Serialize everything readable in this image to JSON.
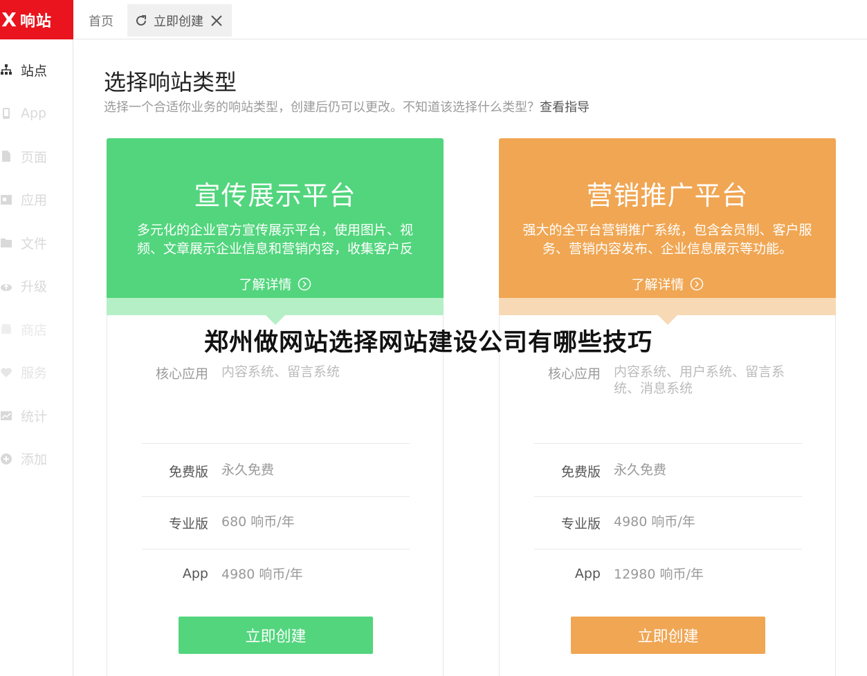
{
  "app": {
    "logo_mark": "X",
    "logo_text": "响站",
    "brand_color": "#e9141d"
  },
  "tabs": {
    "home": "首页",
    "current": "立即创建"
  },
  "sidebar": {
    "items": [
      {
        "label": "站点",
        "icon": "sitemap-icon"
      },
      {
        "label": "App",
        "icon": "mobile-icon"
      },
      {
        "label": "页面",
        "icon": "page-icon"
      },
      {
        "label": "应用",
        "icon": "app-icon"
      },
      {
        "label": "文件",
        "icon": "folder-icon"
      },
      {
        "label": "升级",
        "icon": "cloud-upload-icon"
      },
      {
        "label": "商店",
        "icon": "store-icon"
      },
      {
        "label": "服务",
        "icon": "heart-icon"
      },
      {
        "label": "统计",
        "icon": "chart-icon"
      },
      {
        "label": "添加",
        "icon": "plus-circle-icon"
      }
    ]
  },
  "main": {
    "title": "选择响站类型",
    "subtitle": "选择一个合适你业务的响站类型，创建后仍可以更改。不知道该选择什么类型？",
    "guide_link": "查看指导"
  },
  "cards": [
    {
      "title": "宣传展示平台",
      "desc": "多元化的企业官方宣传展示平台，使用图片、视频、文章展示企业信息和营销内容，收集客户反",
      "more": "了解详情",
      "core_label": "核心应用",
      "core_value": "内容系统、留言系统",
      "rows": [
        {
          "k": "免费版",
          "v": "永久免费"
        },
        {
          "k": "专业版",
          "v": "680 响币/年"
        },
        {
          "k": "App",
          "v": "4980 响币/年"
        }
      ],
      "cta": "立即创建",
      "color": "#52d57d"
    },
    {
      "title": "营销推广平台",
      "desc": "强大的全平台营销推广系统，包含会员制、客户服务、营销内容发布、企业信息展示等功能。",
      "more": "了解详情",
      "core_label": "核心应用",
      "core_value": "内容系统、用户系统、留言系统、消息系统",
      "rows": [
        {
          "k": "免费版",
          "v": "永久免费"
        },
        {
          "k": "专业版",
          "v": "4980 响币/年"
        },
        {
          "k": "App",
          "v": "12980 响币/年"
        }
      ],
      "cta": "立即创建",
      "color": "#f0a653"
    }
  ],
  "overlay_text": "郑州做网站选择网站建设公司有哪些技巧"
}
